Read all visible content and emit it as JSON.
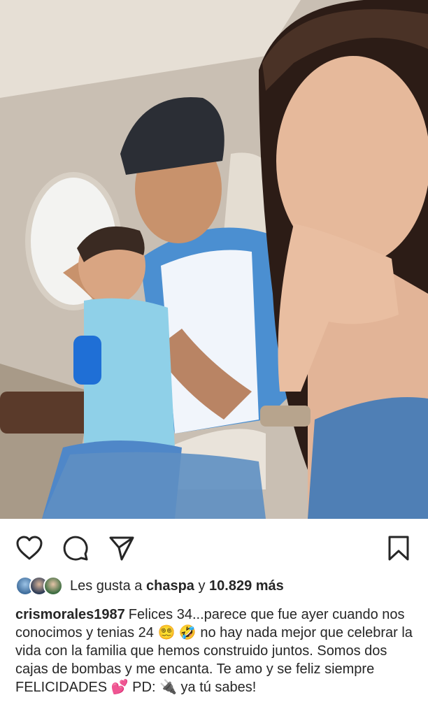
{
  "post": {
    "photo": {
      "icon": "photo-airplane-cabin-selfie"
    },
    "actions": {
      "like_icon": "heart-icon",
      "comment_icon": "comment-icon",
      "share_icon": "send-icon",
      "save_icon": "bookmark-icon"
    },
    "likes": {
      "prefix": "Les gusta a",
      "liker": "chaspa",
      "joiner": "y",
      "count": "10.829 más"
    },
    "caption": {
      "username": "crismorales1987",
      "text": "Felices 34...parece que fue ayer cuando nos conocimos y tenias 24 😵‍💫 🤣 no hay nada mejor que celebrar la vida con la familia que hemos construido juntos. Somos dos cajas de bombas y me encanta. Te amo y se feliz siempre FELICIDADES 💕 PD: 🔌 ya tú sabes!"
    }
  },
  "colors": {
    "text": "#262626",
    "background": "#ffffff"
  }
}
